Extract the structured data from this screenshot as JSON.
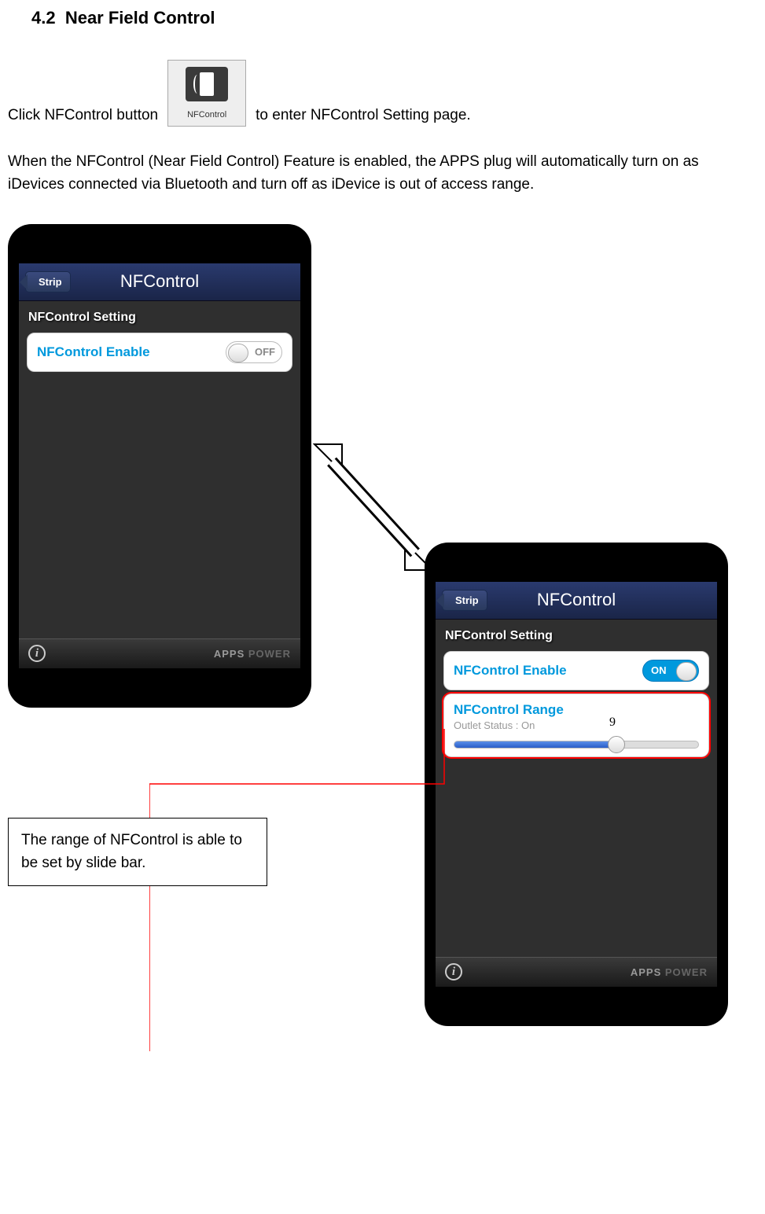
{
  "section": {
    "number": "4.2",
    "title": "Near Field Control"
  },
  "para1": {
    "before": "Click NFControl button",
    "after": "to enter NFControl Setting page.",
    "icon_label": "NFControl"
  },
  "para2": "When the NFControl    (Near Field Control) Feature is enabled, the APPS plug will automatically turn on as iDevices connected via Bluetooth and turn off as iDevice is out of access range.",
  "phone1": {
    "back_label": "Strip",
    "title": "NFControl",
    "section_label": "NFControl Setting",
    "enable_label": "NFControl Enable",
    "toggle_text": "OFF",
    "footer_brand": "APPS",
    "footer_brand2": "POWER"
  },
  "phone2": {
    "back_label": "Strip",
    "title": "NFControl",
    "section_label": "NFControl Setting",
    "enable_label": "NFControl Enable",
    "toggle_text": "ON",
    "range_label": "NFControl Range",
    "range_sub": "Outlet Status : On",
    "footer_brand": "APPS",
    "footer_brand2": "POWER"
  },
  "callout": "The range of NFControl is able to be set by slide bar.",
  "page_number": "9"
}
